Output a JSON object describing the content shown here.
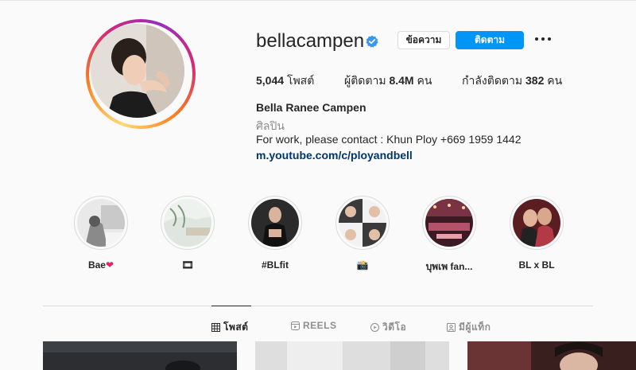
{
  "profile": {
    "username": "bellacampen",
    "verified_icon": "verified-badge-icon",
    "message_label": "ข้อความ",
    "follow_label": "ติดตาม",
    "more_icon": "more-options-icon"
  },
  "stats": {
    "posts": "5,044",
    "posts_label": "โพสต์",
    "followers_label": "ผู้ติดตาม",
    "followers": "8.4M",
    "followers_unit": "คน",
    "following_label": "กำลังติดตาม",
    "following": "382",
    "following_unit": "คน"
  },
  "bio": {
    "full_name": "Bella Ranee Campen",
    "category": "ศิลปิน",
    "text": "For work, please contact : Khun Ploy +669 1959 1442",
    "link": "m.youtube.com/c/ployandbell"
  },
  "highlights": [
    {
      "label": "Bae",
      "suffix": "❤"
    },
    {
      "label": "🎞"
    },
    {
      "label": "#BLfit"
    },
    {
      "label": "📸"
    },
    {
      "label": "บุพเพ fan..."
    },
    {
      "label": "BL x BL"
    }
  ],
  "tabs": [
    {
      "label": "โพสต์",
      "icon": "grid-icon",
      "active": true
    },
    {
      "label": "REELS",
      "icon": "reels-icon",
      "active": false
    },
    {
      "label": "วิดีโอ",
      "icon": "video-icon",
      "active": false
    },
    {
      "label": "มีผู้แท็ก",
      "icon": "tagged-icon",
      "active": false
    }
  ],
  "colors": {
    "accent": "#0095f6",
    "link": "#00376b",
    "muted": "#8e8e8e",
    "heart": "#e0245e"
  }
}
